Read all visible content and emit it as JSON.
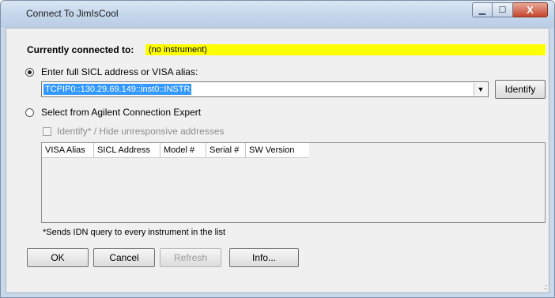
{
  "window": {
    "title": "Connect To JimIsCool",
    "minimize_glyph": "▁",
    "maximize_glyph": "☐",
    "close_glyph": "X"
  },
  "status": {
    "label": "Currently connected to:",
    "value": "(no instrument)"
  },
  "option_address": {
    "label": "Enter full SICL address or VISA alias:",
    "selected": true,
    "address_value": "TCPIP0::130.29.69.149::inst0::INSTR",
    "identify_label": "Identify"
  },
  "option_ace": {
    "label": "Select from Agilent Connection Expert",
    "selected": false,
    "identify_checkbox_label": "Identify* / Hide unresponsive addresses"
  },
  "table": {
    "columns": [
      "VISA Alias",
      "SICL Address",
      "Model #",
      "Serial #",
      "SW Version"
    ],
    "rows": []
  },
  "footnote": "*Sends IDN query to every instrument in the list",
  "buttons": {
    "ok": "OK",
    "cancel": "Cancel",
    "refresh": "Refresh",
    "info": "Info..."
  },
  "colors": {
    "status_highlight": "#ffff00",
    "selection": "#3399ff",
    "close_button": "#c4452c"
  }
}
